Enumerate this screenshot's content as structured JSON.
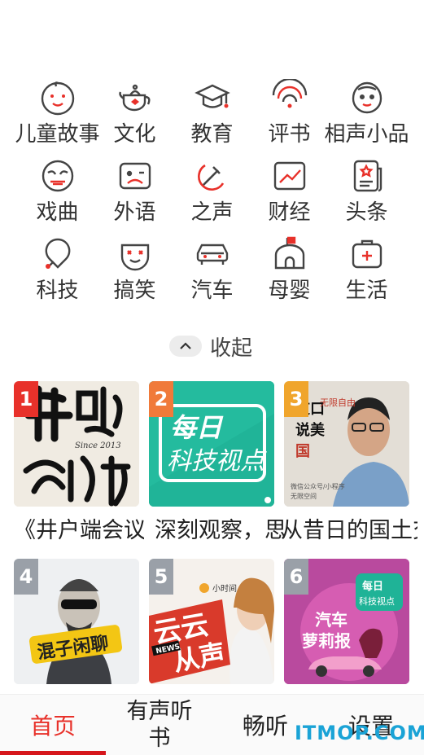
{
  "categories": [
    [
      {
        "label": "儿童故事",
        "icon": "baby-face-icon"
      },
      {
        "label": "文化",
        "icon": "teapot-icon"
      },
      {
        "label": "教育",
        "icon": "graduation-cap-icon"
      },
      {
        "label": "评书",
        "icon": "fan-icon"
      },
      {
        "label": "相声小品",
        "icon": "comedian-face-icon"
      }
    ],
    [
      {
        "label": "戏曲",
        "icon": "opera-mask-icon"
      },
      {
        "label": "外语",
        "icon": "language-card-icon"
      },
      {
        "label": "之声",
        "icon": "hammer-sickle-icon"
      },
      {
        "label": "财经",
        "icon": "trend-chart-icon"
      },
      {
        "label": "头条",
        "icon": "news-star-icon"
      }
    ],
    [
      {
        "label": "科技",
        "icon": "bulb-icon"
      },
      {
        "label": "搞笑",
        "icon": "funny-face-icon"
      },
      {
        "label": "汽车",
        "icon": "car-icon"
      },
      {
        "label": "母婴",
        "icon": "house-flag-icon"
      },
      {
        "label": "生活",
        "icon": "medkit-icon"
      }
    ]
  ],
  "collapse": {
    "label": "收起",
    "icon": "chevron-up-icon"
  },
  "cards": [
    {
      "rank": "1",
      "title": "《井户端会议》目",
      "cover_text": "井户端 会議",
      "cover_sub": "Since 2013"
    },
    {
      "rank": "2",
      "title": "深刻观察，思科",
      "cover_text": "每日 科技视点"
    },
    {
      "rank": "3",
      "title": "从昔日的国土交策到第",
      "cover_text": "道口说美国",
      "cover_sub": "无限自由",
      "cover_caption": "微信公众号/小程序 无限空间"
    },
    {
      "rank": "4",
      "cover_text": "混子闲聊"
    },
    {
      "rank": "5",
      "cover_text": "云云从声",
      "cover_sub": "小时间",
      "cover_tag": "NEWS"
    },
    {
      "rank": "6",
      "cover_text": "汽车 萝莉报",
      "cover_sub": "每日 科技视点"
    }
  ],
  "nav": [
    {
      "label": "首页",
      "active": true
    },
    {
      "label": "有声听书",
      "active": false
    },
    {
      "label": "畅听",
      "active": false
    },
    {
      "label": "设置",
      "active": false
    }
  ],
  "watermark": "ITMOP.COM",
  "colors": {
    "accent": "#e8312a",
    "icon_stroke": "#444444"
  }
}
